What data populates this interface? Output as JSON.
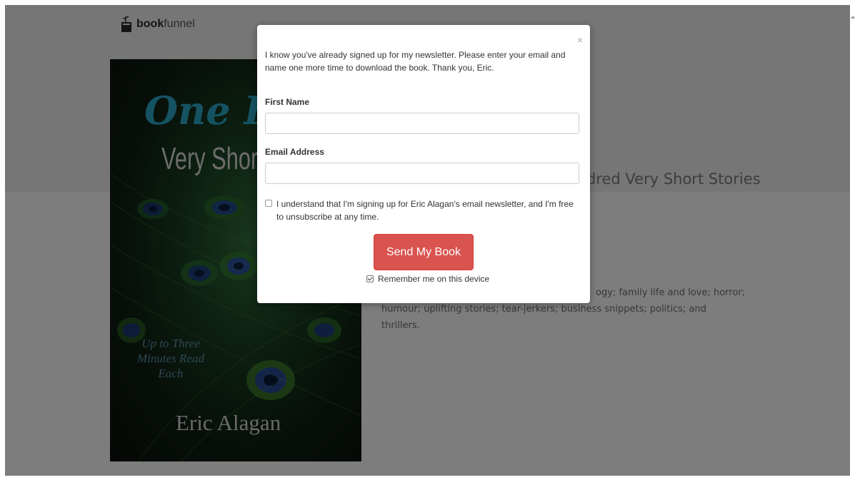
{
  "brand": {
    "logo_bold": "book",
    "logo_light": "funnel"
  },
  "book": {
    "cover_title_line1": "One Hu",
    "cover_title_line2": "Very Short S",
    "cover_tagline": "Up to Three Minutes Read Each",
    "cover_author": "Eric Alagan",
    "title_visible": "dred Very Short Stories",
    "description_line1": "ogy; family life and love; horror;",
    "description_line2": "humour; uplifting stories; tear-jerkers; business snippets; politics; and thrillers."
  },
  "modal": {
    "close_symbol": "×",
    "message": "I know you've already signed up for my newsletter. Please enter your email and name one more time to download the book. Thank you, Eric.",
    "first_name_label": "First Name",
    "first_name_value": "",
    "email_label": "Email Address",
    "email_value": "",
    "consent_text": "I understand that I'm signing up for Eric Alagan's email newsletter, and I'm free to unsubscribe at any time.",
    "consent_checked": false,
    "submit_label": "Send My Book",
    "remember_text": "Remember me on this device",
    "remember_checked": true
  },
  "colors": {
    "overlay": "#000000",
    "button": "#d9534f",
    "cover_title": "#2aa6c4"
  },
  "icons": {
    "logo": "bookfunnel-logo-icon",
    "close": "close-icon"
  }
}
